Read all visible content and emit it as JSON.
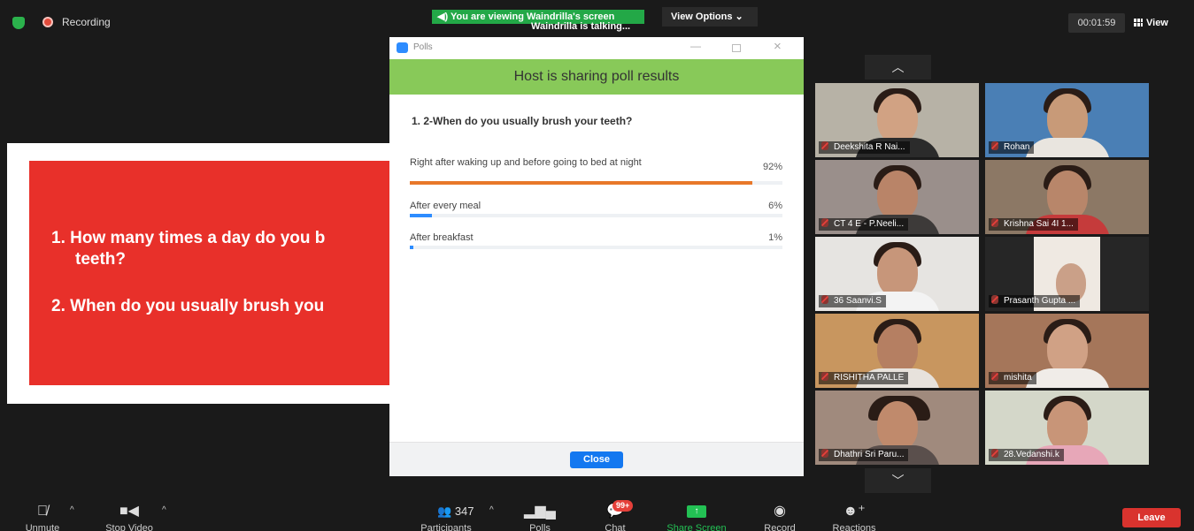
{
  "topbar": {
    "recording_label": "Recording",
    "viewing_banner": "You are viewing Waindrilla's screen",
    "talking_label": "Waindrilla is talking...",
    "view_options_label": "View Options",
    "timer": "00:01:59",
    "view_label": "View"
  },
  "slide": {
    "line1": "1. How many times a day do you b",
    "line2": "teeth?",
    "line3": "2. When do you usually brush you",
    "background_color": "#e8302a"
  },
  "polls": {
    "window_title": "Polls",
    "header": "Host is sharing poll results",
    "header_color": "#88c959",
    "question": "1. 2-When do you usually brush your teeth?",
    "options": [
      {
        "label": "Right after waking up and before going to bed at night",
        "pct": "92%",
        "value": 0.92,
        "color": "#e8782a"
      },
      {
        "label": "After every meal",
        "pct": "6%",
        "value": 0.06,
        "color": "#2d8cff"
      },
      {
        "label": "After breakfast",
        "pct": "1%",
        "value": 0.01,
        "color": "#2d8cff"
      }
    ],
    "close_label": "Close"
  },
  "gallery": {
    "participants": [
      {
        "name": "Deekshita R Nai..."
      },
      {
        "name": "Rohan"
      },
      {
        "name": "CT 4 E - P.Neeli..."
      },
      {
        "name": "Krishna Sai 4I 1..."
      },
      {
        "name": "36 Saanvi.S"
      },
      {
        "name": "Prasanth Gupta ..."
      },
      {
        "name": "RISHITHA PALLE"
      },
      {
        "name": "mishita"
      },
      {
        "name": "Dhathri Sri Paru..."
      },
      {
        "name": "28.Vedanshi.k"
      }
    ]
  },
  "toolbar": {
    "unmute_label": "Unmute",
    "stop_video_label": "Stop Video",
    "participants_label": "Participants",
    "participants_count": "347",
    "polls_label": "Polls",
    "chat_label": "Chat",
    "chat_badge": "99+",
    "share_screen_label": "Share Screen",
    "record_label": "Record",
    "reactions_label": "Reactions",
    "leave_label": "Leave",
    "share_color": "#23c154",
    "leave_color": "#d9332e"
  }
}
